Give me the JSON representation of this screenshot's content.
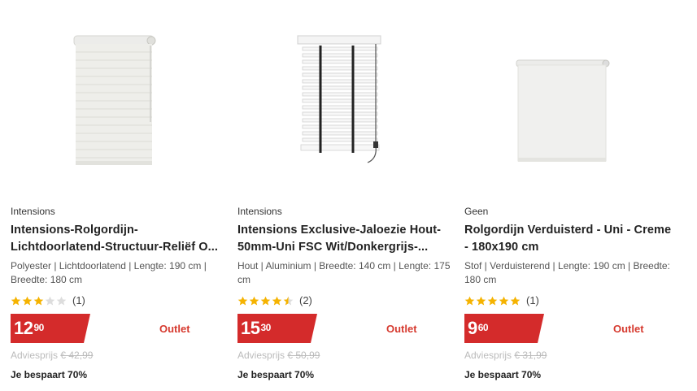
{
  "products": [
    {
      "brand": "Intensions",
      "title": "Intensions-Rolgordijn-Lichtdoorlatend-Structuur-Reliëf O...",
      "specs": "Polyester | Lichtdoorlatend | Lengte: 190 cm | Breedte: 180 cm",
      "rating": 3,
      "rating_count": "(1)",
      "price_main": "12",
      "price_cents": "90",
      "outlet": "Outlet",
      "advies_label": "Adviesprijs",
      "advies_price": "€ 42,99",
      "savings": "Je bespaart 70%",
      "image": "roller-blind-structured-icon"
    },
    {
      "brand": "Intensions",
      "title": "Intensions Exclusive-Jaloezie Hout-50mm-Uni FSC Wit/Donkergrijs-...",
      "specs": "Hout | Aluminium | Breedte: 140 cm | Lengte: 175 cm",
      "rating": 4.5,
      "rating_count": "(2)",
      "price_main": "15",
      "price_cents": "30",
      "outlet": "Outlet",
      "advies_label": "Adviesprijs",
      "advies_price": "€ 50,99",
      "savings": "Je bespaart 70%",
      "image": "venetian-blind-icon"
    },
    {
      "brand": "Geen",
      "title": "Rolgordijn Verduisterd - Uni - Creme - 180x190 cm",
      "specs": "Stof | Verduisterend | Lengte: 190 cm | Breedte: 180 cm",
      "rating": 5,
      "rating_count": "(1)",
      "price_main": "9",
      "price_cents": "60",
      "outlet": "Outlet",
      "advies_label": "Adviesprijs",
      "advies_price": "€ 31,99",
      "savings": "Je bespaart 70%",
      "image": "roller-blind-plain-icon"
    }
  ],
  "colors": {
    "price_bg": "#d42b2b",
    "outlet": "#d63a2f",
    "star_filled": "#f5b301",
    "star_empty": "#dddddd"
  }
}
